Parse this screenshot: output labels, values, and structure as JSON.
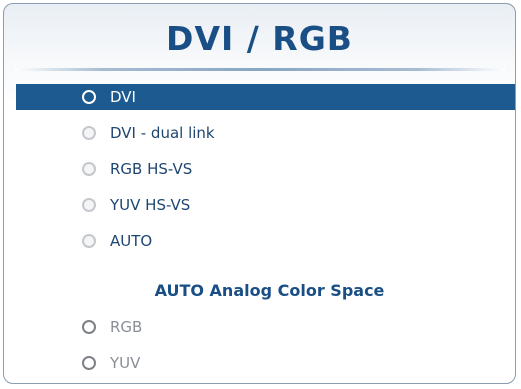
{
  "panel": {
    "title": "DVI / RGB"
  },
  "input_options": [
    {
      "label": "DVI",
      "selected": true
    },
    {
      "label": "DVI - dual link",
      "selected": false
    },
    {
      "label": "RGB HS-VS",
      "selected": false
    },
    {
      "label": "YUV HS-VS",
      "selected": false
    },
    {
      "label": "AUTO",
      "selected": false
    }
  ],
  "color_space": {
    "heading": "AUTO Analog Color Space",
    "options": [
      {
        "label": "RGB",
        "selected": false
      },
      {
        "label": "YUV",
        "selected": false
      }
    ]
  },
  "colors": {
    "accent": "#1a4f86",
    "selection": "#1c5a8f",
    "text": "#1f4670",
    "disabled_text": "#8a8f96"
  }
}
